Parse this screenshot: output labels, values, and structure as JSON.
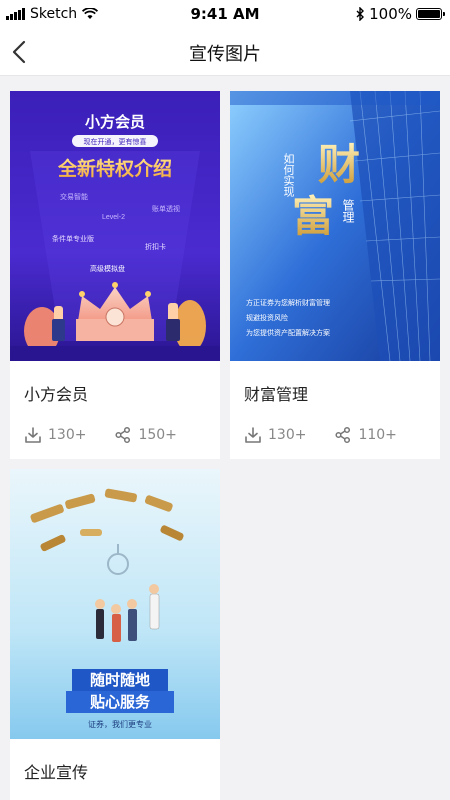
{
  "status_bar": {
    "carrier": "Sketch",
    "time": "9:41 AM",
    "battery": "100%",
    "battery_level": 1.0
  },
  "nav": {
    "title": "宣传图片",
    "back_icon": "chevron-left-icon"
  },
  "cards": [
    {
      "title": "小方会员",
      "downloads": "130+",
      "shares": "150+",
      "poster": {
        "title": "小方会员",
        "tagline": "现在开通，更有惊喜",
        "headline": "全新特权介绍",
        "features": [
          "交易智能",
          "Level-2",
          "账单透视",
          "条件单专业版",
          "折扣卡",
          "高级模拟盘"
        ]
      }
    },
    {
      "title": "财富管理",
      "downloads": "130+",
      "shares": "110+",
      "poster": {
        "prefix": "如何实现",
        "char1": "财",
        "char2": "富",
        "side": "管理",
        "lines": [
          "方正证券为您解析财富管理",
          "规避投资风险",
          "为您提供资产配置解决方案"
        ]
      }
    },
    {
      "title": "企业宣传",
      "poster": {
        "line1": "随时随地",
        "line2": "贴心服务",
        "slogan": "证券，我们更专业"
      }
    }
  ],
  "icons": {
    "download": "download-icon",
    "share": "share-icon"
  }
}
